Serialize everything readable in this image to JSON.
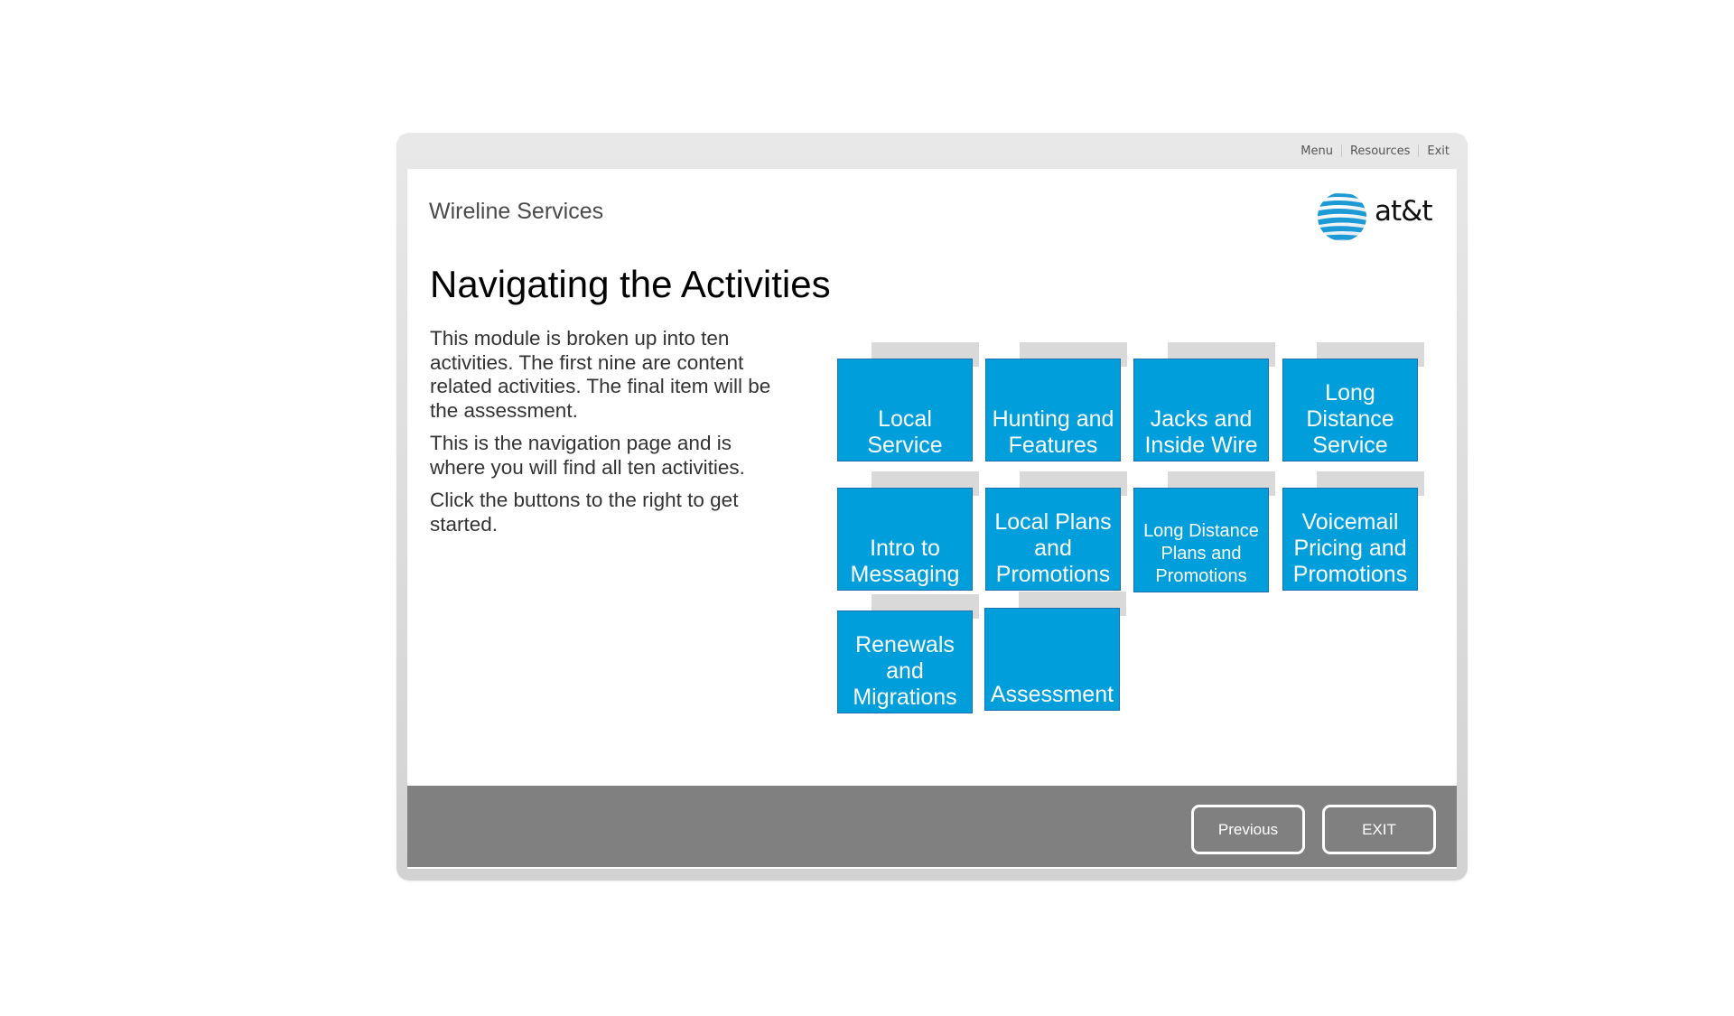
{
  "topnav": {
    "items": [
      "Menu",
      "Resources",
      "Exit"
    ]
  },
  "header": {
    "course_title": "Wireline Services",
    "logo_text": "at&t"
  },
  "main": {
    "title": "Navigating the Activities",
    "paragraphs": [
      "This module is broken up into ten activities.  The first nine are content related activities. The final item will be the assessment.",
      "This is the navigation page and is where you will find all ten activities.",
      "Click the buttons to the right to get started."
    ]
  },
  "activities": [
    {
      "label": "Local\nService"
    },
    {
      "label": "Hunting and\nFeatures"
    },
    {
      "label": "Jacks and\nInside Wire"
    },
    {
      "label": "Long\nDistance\nService"
    },
    {
      "label": "Intro to\nMessaging"
    },
    {
      "label": "Local Plans\nand\nPromotions"
    },
    {
      "label": "Long Distance\nPlans and\nPromotions"
    },
    {
      "label": "Voicemail\nPricing and\nPromotions"
    },
    {
      "label": "Renewals\nand\nMigrations"
    },
    {
      "label": "Assessment"
    }
  ],
  "footer": {
    "previous_label": "Previous",
    "exit_label": "EXIT"
  },
  "colors": {
    "tile": "#009fdb",
    "tile_border": "#1b6fae",
    "footer": "#808080"
  }
}
